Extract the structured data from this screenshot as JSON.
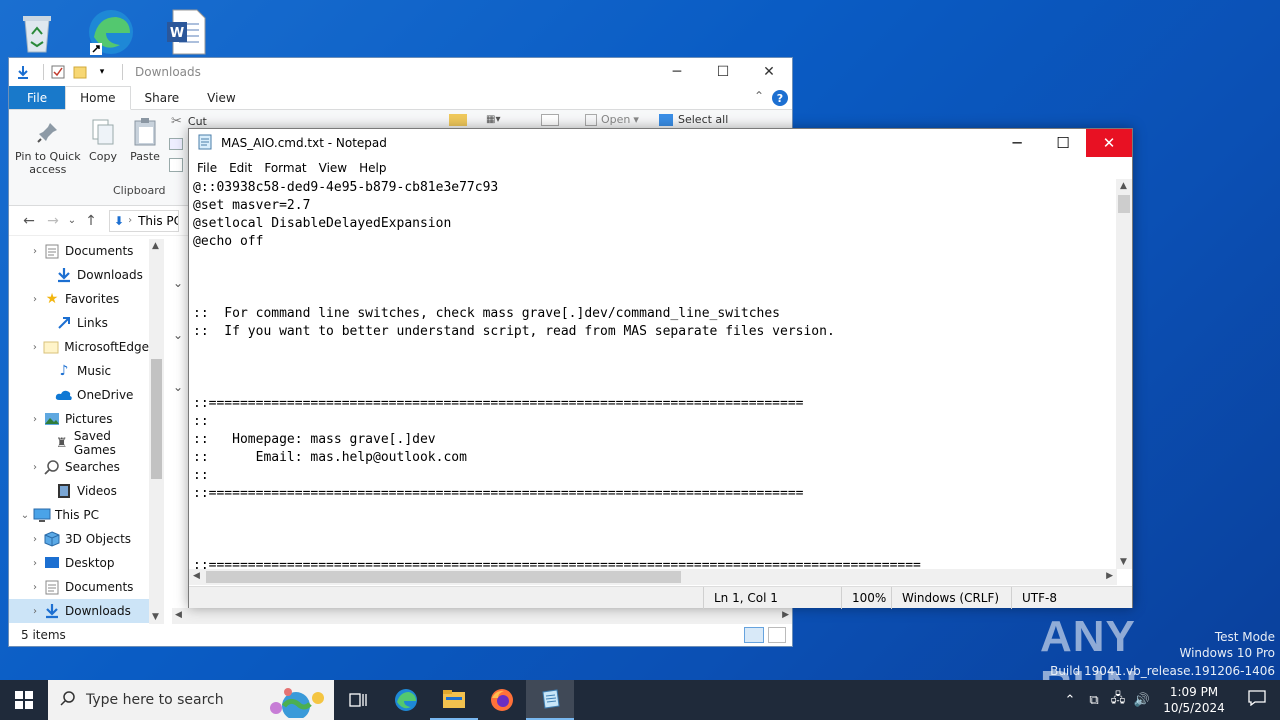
{
  "explorer": {
    "title": "Downloads",
    "tabs": [
      "File",
      "Home",
      "Share",
      "View"
    ],
    "ribbon": {
      "pin_label_1": "Pin to Quick",
      "pin_label_2": "access",
      "copy_label": "Copy",
      "paste_label": "Paste",
      "cut_label": "Cut",
      "open_label": "Open",
      "select_all_label": "Select all",
      "clipboard_group": "Clipboard"
    },
    "address": "This PC",
    "nav_items": [
      {
        "label": "Documents",
        "icon": "document-folder-icon",
        "chevron": true
      },
      {
        "label": "Downloads",
        "icon": "download-folder-icon",
        "chevron": false
      },
      {
        "label": "Favorites",
        "icon": "star-icon",
        "chevron": true
      },
      {
        "label": "Links",
        "icon": "links-folder-icon",
        "chevron": false
      },
      {
        "label": "MicrosoftEdge",
        "icon": "folder-icon",
        "chevron": true
      },
      {
        "label": "Music",
        "icon": "music-icon",
        "chevron": false
      },
      {
        "label": "OneDrive",
        "icon": "cloud-icon",
        "chevron": false
      },
      {
        "label": "Pictures",
        "icon": "pictures-icon",
        "chevron": true
      },
      {
        "label": "Saved Games",
        "icon": "games-icon",
        "chevron": false
      },
      {
        "label": "Searches",
        "icon": "search-folder-icon",
        "chevron": true
      },
      {
        "label": "Videos",
        "icon": "video-icon",
        "chevron": false
      },
      {
        "label": "This PC",
        "icon": "computer-icon",
        "chevron": true
      },
      {
        "label": "3D Objects",
        "icon": "cube-icon",
        "chevron": true
      },
      {
        "label": "Desktop",
        "icon": "desktop-icon",
        "chevron": true
      },
      {
        "label": "Documents",
        "icon": "document-folder-icon",
        "chevron": true
      },
      {
        "label": "Downloads",
        "icon": "download-folder-icon",
        "chevron": true
      }
    ],
    "status": "5 items"
  },
  "notepad": {
    "title": "MAS_AIO.cmd.txt - Notepad",
    "menu": [
      "File",
      "Edit",
      "Format",
      "View",
      "Help"
    ],
    "lines": [
      "@::03938c58-ded9-4e95-b879-cb81e3e77c93",
      "@set masver=2.7",
      "@setlocal DisableDelayedExpansion",
      "@echo off",
      "",
      "",
      "",
      "::  For command line switches, check mass grave[.]dev/command_line_switches",
      "::  If you want to better understand script, read from MAS separate files version.",
      "",
      "",
      "",
      "::============================================================================",
      "::",
      "::   Homepage: mass grave[.]dev",
      "::      Email: mas.help@outlook.com",
      "::",
      "::============================================================================",
      "",
      "",
      "",
      "::==========================================================================================="
    ],
    "status": {
      "position": "Ln 1, Col 1",
      "zoom": "100%",
      "line_ending": "Windows (CRLF)",
      "encoding": "UTF-8"
    }
  },
  "taskbar": {
    "search_placeholder": "Type here to search",
    "time": "1:09 PM",
    "date": "10/5/2024"
  },
  "watermark": {
    "brand": "ANY RUN",
    "line1": "Test Mode",
    "line2": "Windows 10 Pro",
    "line3": "Build 19041.vb_release.191206-1406"
  }
}
